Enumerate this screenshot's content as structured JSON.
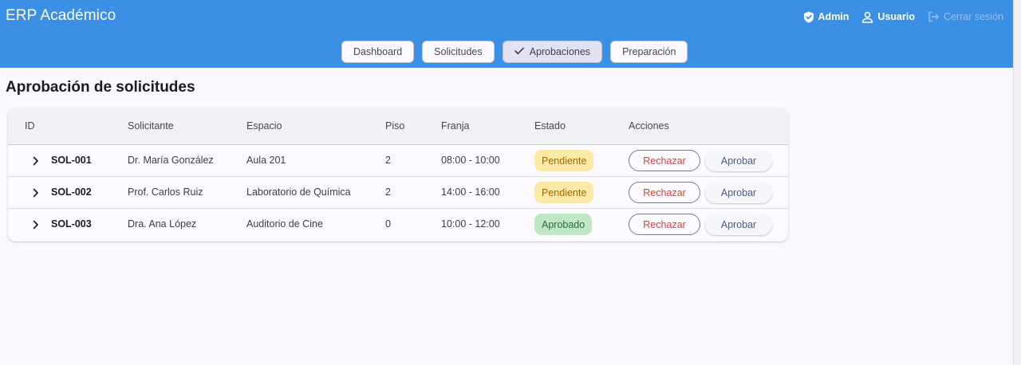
{
  "app": {
    "title": "ERP Académico"
  },
  "header": {
    "admin_label": "Admin",
    "user_label": "Usuario",
    "logout_label": "Cerrar sesión"
  },
  "nav": {
    "tabs": [
      {
        "label": "Dashboard",
        "active": false
      },
      {
        "label": "Solicitudes",
        "active": false
      },
      {
        "label": "Aprobaciones",
        "active": true,
        "icon": "check-icon"
      },
      {
        "label": "Preparación",
        "active": false
      }
    ]
  },
  "page": {
    "title": "Aprobación de solicitudes"
  },
  "table": {
    "columns": [
      "ID",
      "Solicitante",
      "Espacio",
      "Piso",
      "Franja",
      "Estado",
      "Acciones"
    ],
    "rows": [
      {
        "id": "SOL-001",
        "solicitante": "Dr. María González",
        "espacio": "Aula 201",
        "piso": "2",
        "franja": "08:00 - 10:00",
        "estado": "Pendiente",
        "reject": "Rechazar",
        "approve": "Aprobar"
      },
      {
        "id": "SOL-002",
        "solicitante": "Prof. Carlos Ruiz",
        "espacio": "Laboratorio de Química",
        "piso": "2",
        "franja": "14:00 - 16:00",
        "estado": "Pendiente",
        "reject": "Rechazar",
        "approve": "Aprobar"
      },
      {
        "id": "SOL-003",
        "solicitante": "Dra. Ana López",
        "espacio": "Auditorio de Cine",
        "piso": "0",
        "franja": "10:00 - 12:00",
        "estado": "Aprobado",
        "reject": "Rechazar",
        "approve": "Aprobar"
      }
    ]
  },
  "colors": {
    "header_bg": "#3b90e6",
    "pending_chip": "#ffe9a6",
    "approved_chip": "#bfe7c4",
    "reject_text": "#d8403a",
    "approve_text": "#4a5d86"
  }
}
